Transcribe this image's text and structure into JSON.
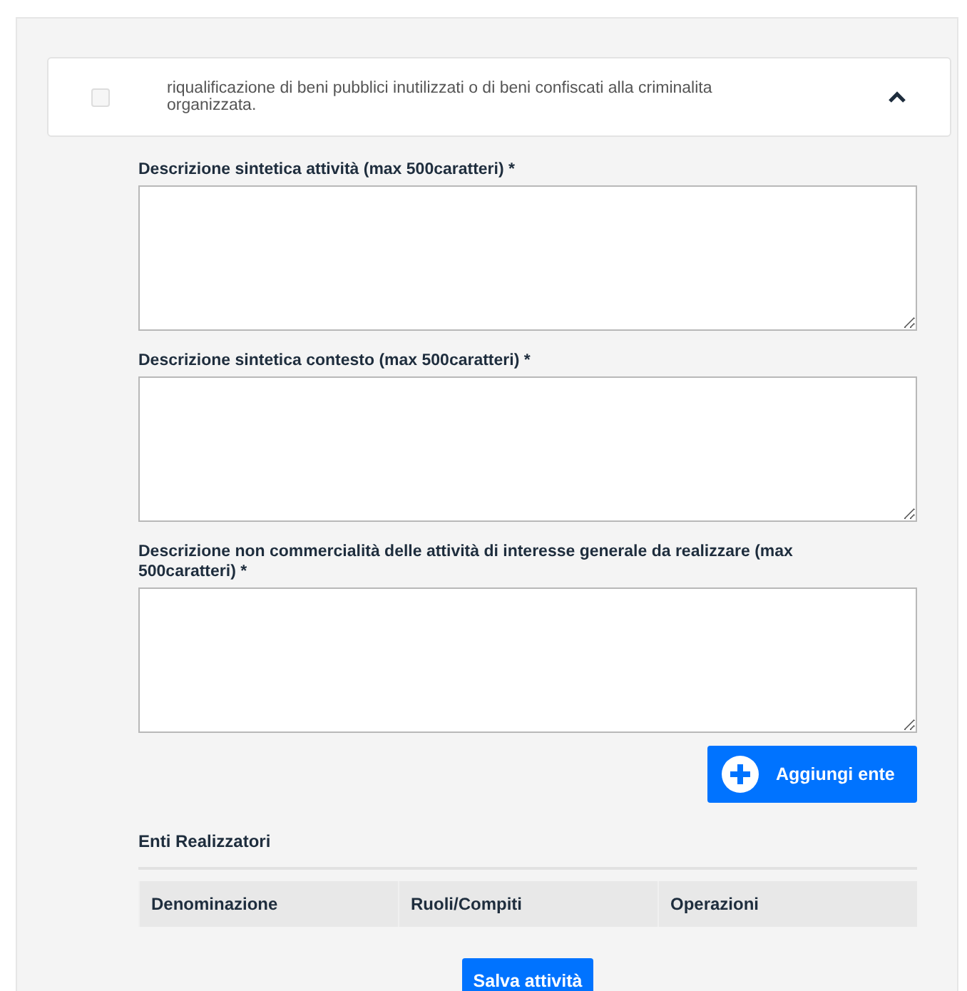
{
  "accordion": {
    "checked": false,
    "expanded": true,
    "title": "riqualificazione di beni pubblici inutilizzati o di beni confiscati alla criminalita organizzata."
  },
  "fields": [
    {
      "label": "Descrizione sintetica attività (max 500caratteri) *"
    },
    {
      "label": "Descrizione sintetica contesto (max 500caratteri) *"
    },
    {
      "label": "Descrizione non commercialità delle attività di interesse generale da realizzare (max 500caratteri) *"
    }
  ],
  "add_button": "Aggiungi ente",
  "section_title": "Enti Realizzatori",
  "table": {
    "columns": [
      "Denominazione",
      "Ruoli/Compiti",
      "Operazioni"
    ]
  },
  "save_button": "Salva attività"
}
